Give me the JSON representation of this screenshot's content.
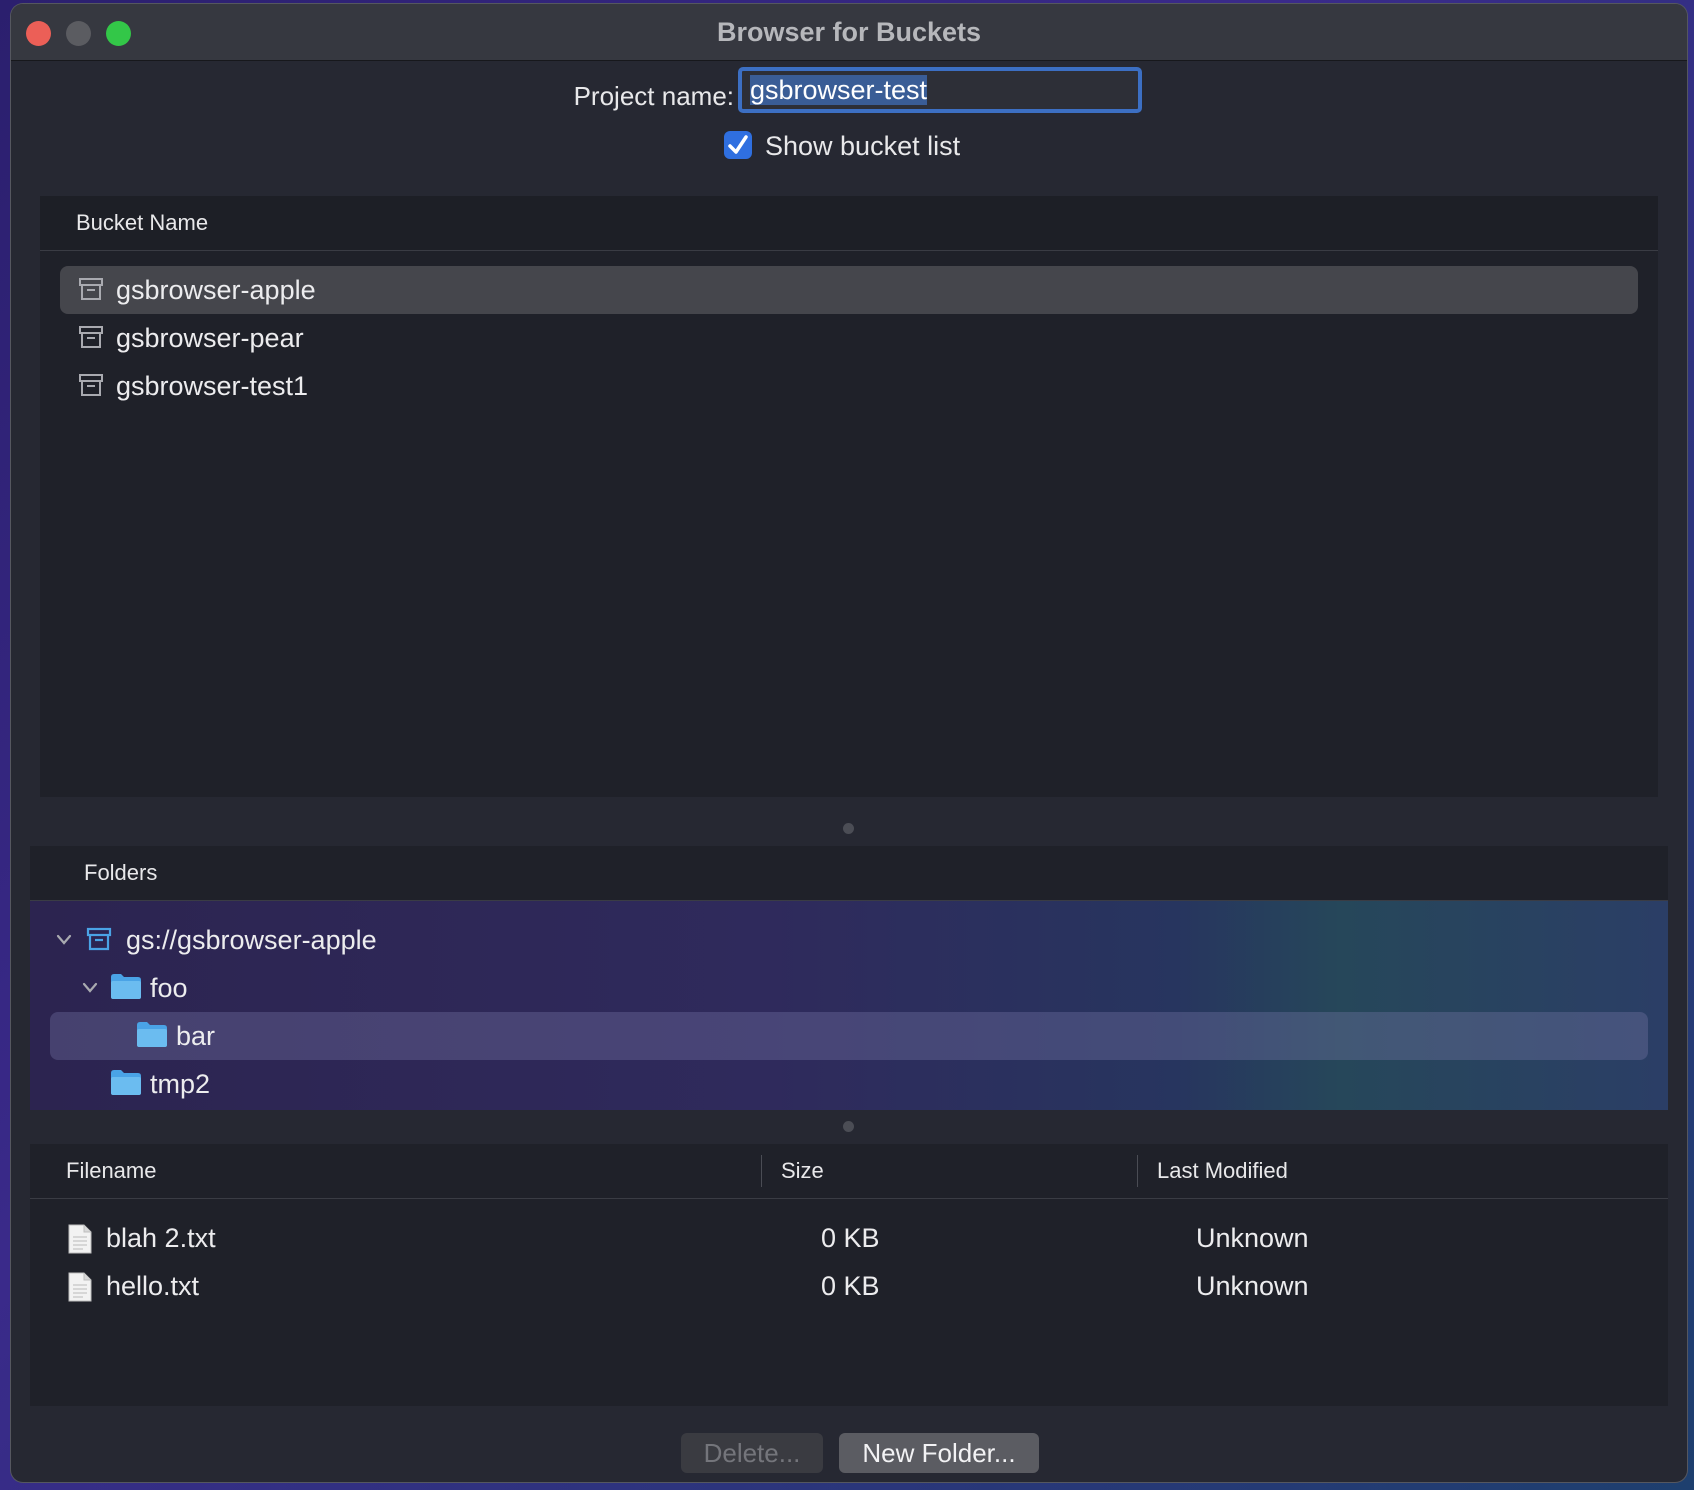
{
  "window": {
    "title": "Browser for Buckets"
  },
  "project": {
    "label": "Project name:",
    "value": "gsbrowser-test"
  },
  "show_bucket_list": {
    "label": "Show bucket list",
    "checked": true
  },
  "buckets": {
    "header": "Bucket Name",
    "items": [
      {
        "name": "gsbrowser-apple",
        "selected": true
      },
      {
        "name": "gsbrowser-pear",
        "selected": false
      },
      {
        "name": "gsbrowser-test1",
        "selected": false
      }
    ]
  },
  "folders": {
    "header": "Folders",
    "tree": [
      {
        "label": "gs://gsbrowser-apple",
        "type": "bucket",
        "expanded": true
      },
      {
        "label": "foo",
        "type": "folder",
        "expanded": true
      },
      {
        "label": "bar",
        "type": "folder",
        "selected": true
      },
      {
        "label": "tmp2",
        "type": "folder"
      }
    ]
  },
  "files": {
    "columns": [
      "Filename",
      "Size",
      "Last Modified"
    ],
    "rows": [
      {
        "filename": "blah 2.txt",
        "size": "0 KB",
        "modified": "Unknown"
      },
      {
        "filename": "hello.txt",
        "size": "0 KB",
        "modified": "Unknown"
      }
    ]
  },
  "buttons": {
    "delete": "Delete...",
    "new_folder": "New Folder..."
  },
  "colors": {
    "accent": "#2f6fe0",
    "folder": "#4aa3e6",
    "selection": "#45464c"
  }
}
